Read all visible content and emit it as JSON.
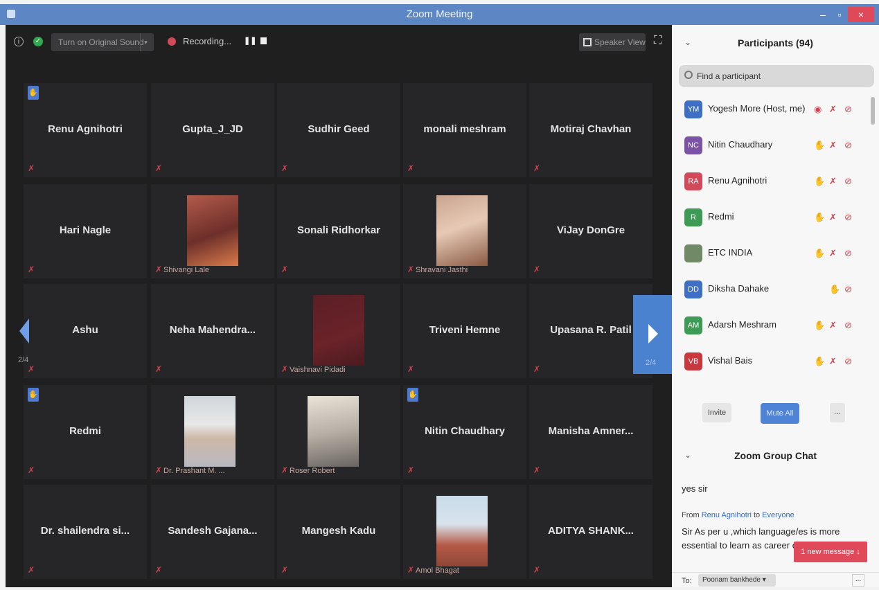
{
  "window": {
    "title": "Zoom Meeting",
    "min_label": "–",
    "max_label": "▫",
    "close_label": "×"
  },
  "toolbar": {
    "sound_button": "Turn on Original Sound",
    "recording_label": "Recording...",
    "pause_icon": "❚❚",
    "speaker_view": "Speaker View",
    "fullscreen_icon": "⛶"
  },
  "pagination": {
    "left": "2/4",
    "right": "2/4"
  },
  "tiles": [
    {
      "name": "Renu Agnihotri",
      "hand": true
    },
    {
      "name": "Gupta_J_JD"
    },
    {
      "name": "Sudhir Geed"
    },
    {
      "name": "monali meshram"
    },
    {
      "name": "Motiraj Chavhan"
    },
    {
      "name": "Hari Nagle"
    },
    {
      "label": "Shivangi Lale",
      "photo": "photo-1"
    },
    {
      "name": "Sonali Ridhorkar"
    },
    {
      "label": "Shravani Jasthi",
      "photo": "photo-2"
    },
    {
      "name": "ViJay DonGre"
    },
    {
      "name": "Ashu"
    },
    {
      "name": "Neha  Mahendra..."
    },
    {
      "label": "Vaishnavi Pidadi",
      "photo": "photo-3"
    },
    {
      "name": "Triveni Hemne"
    },
    {
      "name": "Upasana R. Patil"
    },
    {
      "name": "Redmi",
      "hand": true
    },
    {
      "label": "Dr. Prashant M. ...",
      "photo": "photo-4"
    },
    {
      "label": "Roser Robert",
      "photo": "photo-5"
    },
    {
      "name": "Nitin Chaudhary",
      "hand": true
    },
    {
      "name": "Manisha  Amner..."
    },
    {
      "name": "Dr. shailendra si..."
    },
    {
      "name": "Sandesh  Gajana..."
    },
    {
      "name": "Mangesh Kadu"
    },
    {
      "label": "Amol Bhagat",
      "photo": "photo-6"
    },
    {
      "name": "ADITYA  SHANK..."
    }
  ],
  "participants": {
    "title": "Participants (94)",
    "search_placeholder": "Find a participant",
    "list": [
      {
        "initials": "YM",
        "name": "Yogesh More (Host, me)",
        "color": "#3e6fc4",
        "icons": [
          "rec",
          "mic",
          "cam"
        ]
      },
      {
        "initials": "NC",
        "name": "Nitin Chaudhary",
        "color": "#7a53a6",
        "icons": [
          "hand",
          "mic",
          "cam"
        ]
      },
      {
        "initials": "RA",
        "name": "Renu Agnihotri",
        "color": "#d24a5a",
        "icons": [
          "hand",
          "mic",
          "cam"
        ]
      },
      {
        "initials": "R",
        "name": "Redmi",
        "color": "#3e9b56",
        "icons": [
          "hand",
          "mic",
          "cam"
        ]
      },
      {
        "initials": "",
        "name": "ETC INDIA",
        "color": "#6f8a64",
        "icons": [
          "hand",
          "mic",
          "cam"
        ]
      },
      {
        "initials": "DD",
        "name": "Diksha Dahake",
        "color": "#3e6fc4",
        "icons": [
          "hand",
          "cam"
        ]
      },
      {
        "initials": "AM",
        "name": "Adarsh Meshram",
        "color": "#3e9b56",
        "icons": [
          "hand",
          "mic",
          "cam"
        ]
      },
      {
        "initials": "VB",
        "name": "Vishal Bais",
        "color": "#c9373f",
        "icons": [
          "hand",
          "mic",
          "cam"
        ]
      }
    ],
    "invite": "Invite",
    "mute_all": "Mute All",
    "more": "..."
  },
  "chat": {
    "title": "Zoom Group Chat",
    "message1": "yes sir",
    "from_prefix": "From",
    "from_name": "Renu Agnihotri",
    "to_word": "to",
    "to_name": "Everyone",
    "message2": "Sir As per u ,which language/es is more essential to learn as career o",
    "new_message": "1 new message ↓",
    "to_label": "To:",
    "recipient": "Poonam bankhede ▾",
    "more": "..."
  },
  "colors": {
    "titlebar": "#5c87c4",
    "video_bg": "#1f1f20",
    "tile_bg": "#262628",
    "accent": "#4a82d0",
    "alert": "#e0495a"
  }
}
